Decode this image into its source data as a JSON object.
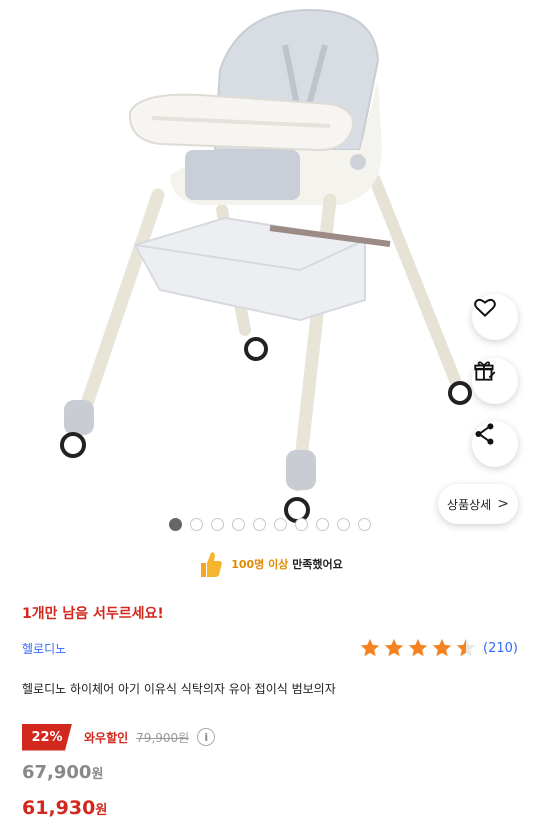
{
  "product_image": {
    "alt": "",
    "dots_total": 10,
    "dots_active_index": 0
  },
  "actions": {
    "wishlist_icon": "heart-icon",
    "gift_icon": "gift-icon",
    "share_icon": "share-icon",
    "detail_label": "상품상세",
    "detail_chevron": ">"
  },
  "satisfaction": {
    "highlight": "100명 이상",
    "rest": "만족했어요"
  },
  "promo_text": "1개만 남음 서두르세요!",
  "brand": "헬로디노",
  "rating": {
    "value": 4.5,
    "max": 5,
    "count_label": "(210)",
    "star_color": "#f5821f"
  },
  "title": "헬로디노 하이체어 아기 이유식 식탁의자 유아 접이식 범보의자",
  "pricing": {
    "discount_badge": "22%",
    "discount_label": "와우할인",
    "original_price": "79,900원",
    "info_icon": "i",
    "price_main": "67,900",
    "price_main_unit": "원",
    "price_final": "61,930",
    "price_final_unit": "원"
  },
  "colors": {
    "accent_red": "#d2281e",
    "link_blue": "#346aff",
    "star_orange": "#f5821f"
  }
}
